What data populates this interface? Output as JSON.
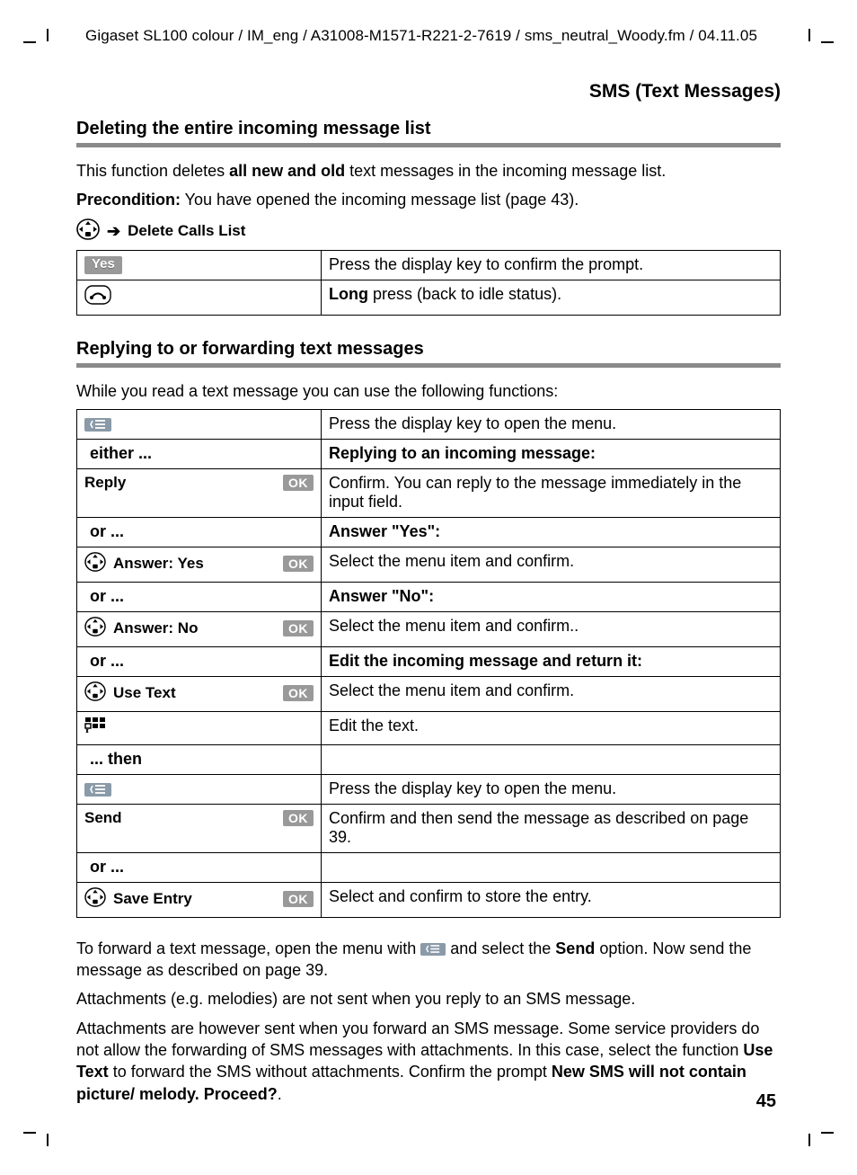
{
  "header": "Gigaset SL100 colour / IM_eng / A31008-M1571-R221-2-7619 / sms_neutral_Woody.fm / 04.11.05",
  "section_title": "SMS (Text Messages)",
  "del": {
    "heading": "Deleting the entire incoming message list",
    "p1_a": "This function deletes ",
    "p1_b": "all new and old",
    "p1_c": " text messages in the incoming message list.",
    "precond_label": "Precondition:",
    "precond_text": " You have opened the incoming message list (page 43).",
    "nav_text": "Delete Calls List",
    "row1_key": "Yes",
    "row1_desc": "Press the display key to confirm the prompt.",
    "row2_desc_b": "Long",
    "row2_desc": " press (back to idle status)."
  },
  "reply": {
    "heading": "Replying to or forwarding text messages",
    "intro": "While you read a text message you can use the following functions:",
    "r1_desc": "Press the display key to open the menu.",
    "either": "either ...",
    "r2_desc": "Replying to an incoming message:",
    "r3_label": "Reply",
    "r3_desc": "Confirm. You can reply to the message immediately in the input field.",
    "or": "or ...",
    "r4_desc": "Answer \"Yes\":",
    "r5_label": "Answer: Yes",
    "r5_desc": "Select the menu item and confirm.",
    "r6_desc": "Answer \"No\":",
    "r7_label": "Answer: No",
    "r7_desc": "Select the menu item and confirm..",
    "r8_desc": "Edit the incoming message and return it:",
    "r9_label": "Use Text",
    "r9_desc": "Select the menu item and confirm.",
    "r10_desc": "Edit the text.",
    "then": "... then",
    "r11_desc": "Press the display key to open the menu.",
    "r12_label": "Send",
    "r12_desc": "Confirm and then send the message as described on page 39.",
    "r13_label": "Save Entry",
    "r13_desc": "Select and confirm to store the entry.",
    "ok": "OK"
  },
  "trail": {
    "p1a": "To forward a text message, open the menu with ",
    "p1b": " and select the ",
    "p1c": "Send",
    "p1d": " option. Now send the message as described on page 39.",
    "p2": "Attachments (e.g. melodies) are not sent when you reply to an SMS message.",
    "p3a": "Attachments are however sent when you forward an SMS message. Some service providers do not allow the forwarding of SMS messages with attachments. In this case, select the function ",
    "p3b": "Use Text",
    "p3c": " to forward the SMS without attachments. Confirm the prompt ",
    "p3d": "New SMS will not contain picture/ melody. Proceed?",
    "p3e": "."
  },
  "page_number": "45"
}
